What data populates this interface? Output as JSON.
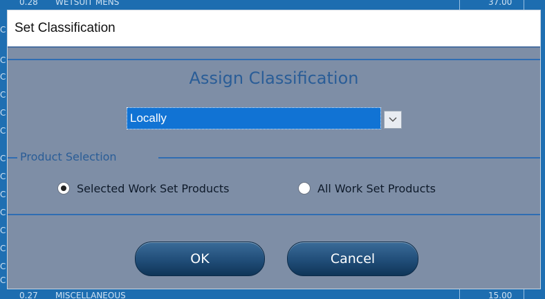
{
  "background": {
    "top_row": {
      "col1": "0.28",
      "col2": "WETSUIT MENS",
      "col3": "37.00"
    },
    "bottom_row": {
      "col1": "0.27",
      "col2": "MISCELLANEOUS",
      "col3": "15.00"
    },
    "left_stubs": [
      "C",
      "C",
      "C",
      "C",
      "C",
      "C",
      "C",
      "C",
      "C",
      "C",
      "C",
      "C",
      "C",
      "C",
      "C"
    ]
  },
  "dialog": {
    "title": "Set Classification",
    "heading": "Assign Classification",
    "select": {
      "value": "Locally",
      "arrow_icon": "chevron-down-icon"
    },
    "product_selection": {
      "legend": "Product Selection",
      "options": [
        {
          "label": "Selected Work Set Products",
          "checked": true
        },
        {
          "label": "All Work Set Products",
          "checked": false
        }
      ]
    },
    "buttons": {
      "ok": "OK",
      "cancel": "Cancel"
    }
  },
  "colors": {
    "dialog_bg": "#7e8ea6",
    "accent": "#2a5d97",
    "select_highlight": "#1173d4",
    "button": "#204d78"
  }
}
